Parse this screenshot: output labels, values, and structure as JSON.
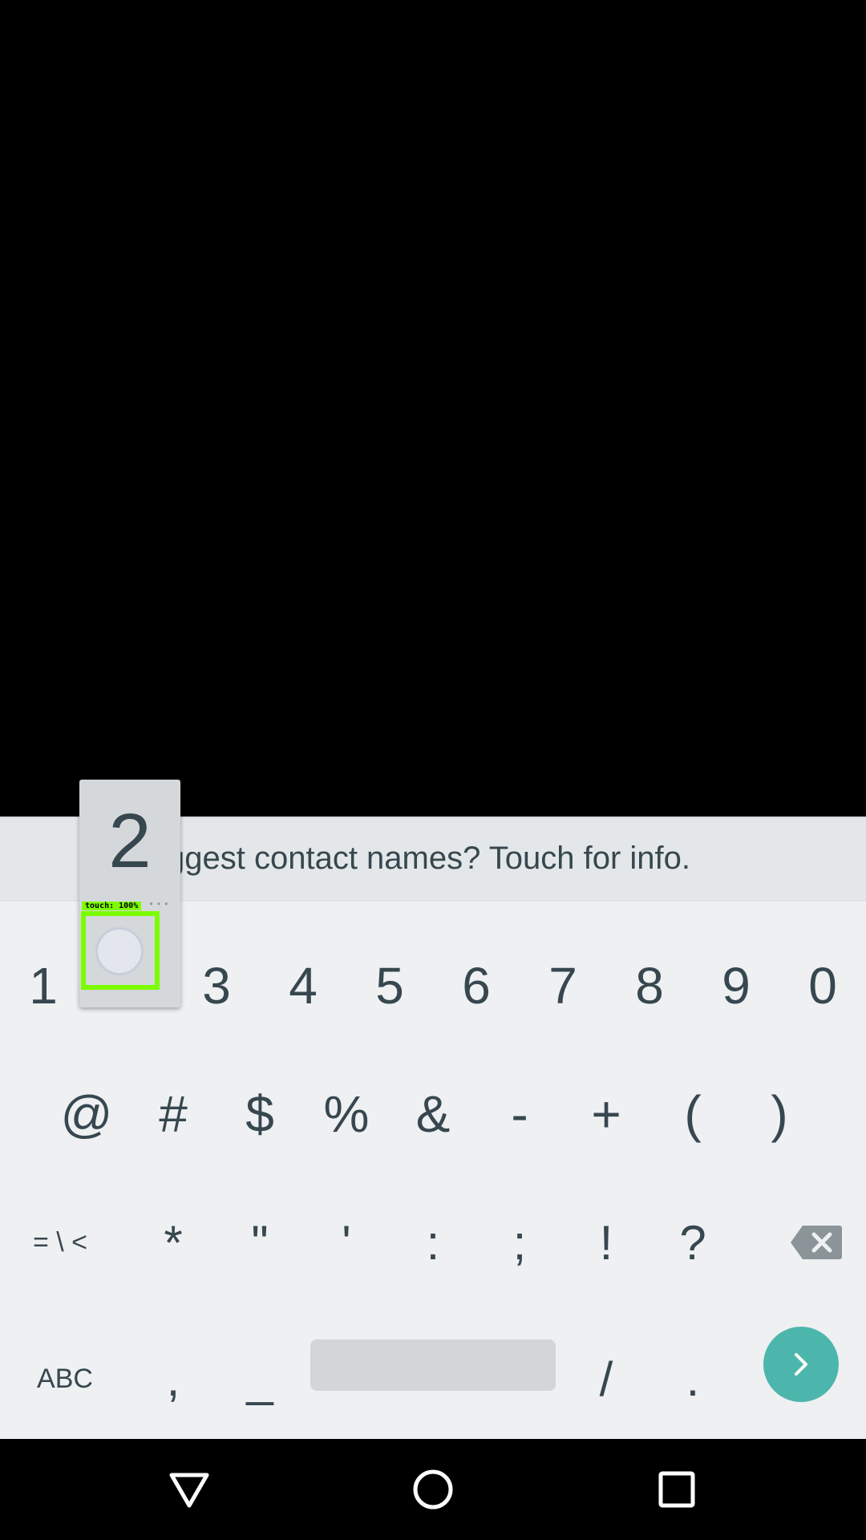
{
  "suggestion_strip": {
    "text": "ggest contact names? Touch for info."
  },
  "key_preview": {
    "label": "2",
    "more_indicator": "...",
    "touch_overlay": "touch: 100%"
  },
  "keyboard": {
    "row1": [
      "1",
      "3",
      "4",
      "5",
      "6",
      "7",
      "8",
      "9",
      "0"
    ],
    "row2": [
      "@",
      "#",
      "$",
      "%",
      "&",
      "-",
      "+",
      "(",
      ")"
    ],
    "row3": {
      "more_symbols": "= \\ <",
      "keys": [
        "*",
        "\"",
        "'",
        ":",
        ";",
        "!",
        "?"
      ]
    },
    "row4": {
      "abc": "ABC",
      "comma": ",",
      "underscore": "_",
      "slash": "/",
      "period": "."
    },
    "icons": {
      "backspace": "backspace-icon",
      "enter": "chevron-right-icon"
    },
    "colors": {
      "enter_button": "#4DB6AC",
      "key_text": "#37474F",
      "touch_box": "#7CFC00"
    }
  },
  "nav_bar": {
    "icons": [
      "back-triangle-icon",
      "home-circle-icon",
      "recents-square-icon"
    ]
  }
}
